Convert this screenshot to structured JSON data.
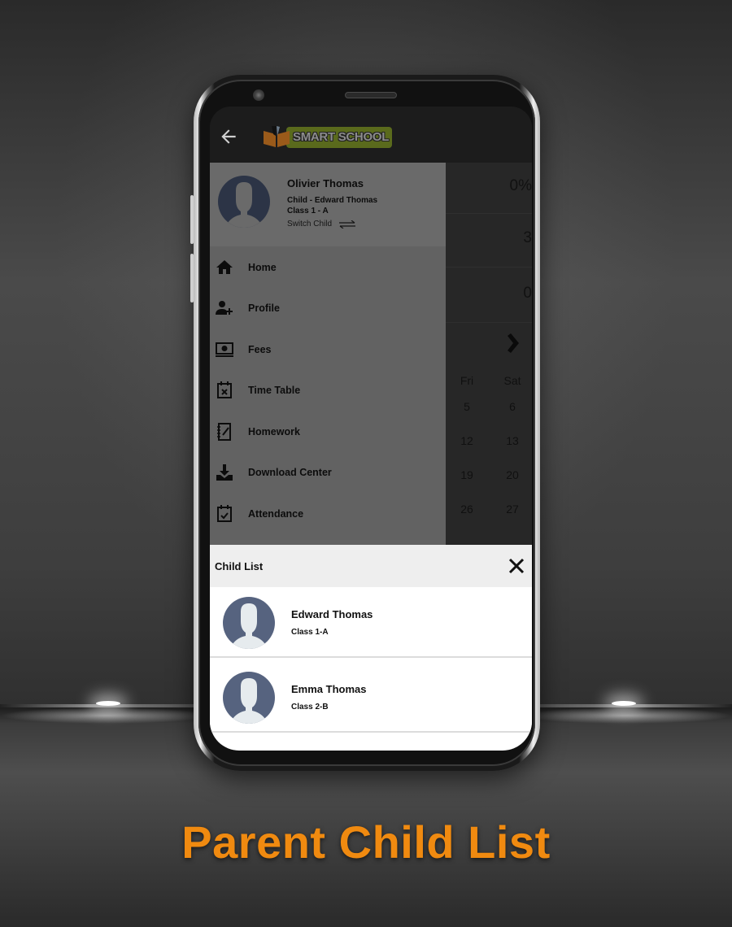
{
  "caption": "Parent Child List",
  "app": {
    "logo_text": "SMART SCHOOL",
    "back_icon": "arrow-left-icon"
  },
  "drawer": {
    "parent_name": "Olivier Thomas",
    "child_line": "Child - Edward Thomas",
    "class_line": "Class 1 - A",
    "switch_label": "Switch Child",
    "items": [
      {
        "label": "Home",
        "icon": "home-icon"
      },
      {
        "label": "Profile",
        "icon": "add-user-icon"
      },
      {
        "label": "Fees",
        "icon": "fees-icon"
      },
      {
        "label": "Time Table",
        "icon": "calendar-x-icon"
      },
      {
        "label": "Homework",
        "icon": "notebook-icon"
      },
      {
        "label": "Download Center",
        "icon": "download-icon"
      },
      {
        "label": "Attendance",
        "icon": "calendar-check-icon"
      }
    ]
  },
  "background": {
    "stats": [
      "0%",
      "3",
      "0"
    ],
    "calendar": {
      "headers": [
        "Fri",
        "Sat"
      ],
      "rows": [
        [
          "5",
          "6"
        ],
        [
          "12",
          "13"
        ],
        [
          "19",
          "20"
        ],
        [
          "26",
          "27"
        ]
      ]
    }
  },
  "child_list": {
    "title": "Child List",
    "children": [
      {
        "name": "Edward Thomas",
        "class": "Class 1-A"
      },
      {
        "name": "Emma Thomas",
        "class": "Class 2-B"
      }
    ]
  },
  "colors": {
    "caption": "#f08a10",
    "avatar": "#56637f",
    "logo_badge": "#5a6a1c"
  }
}
